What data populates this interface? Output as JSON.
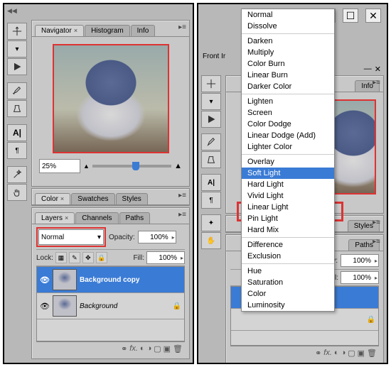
{
  "left": {
    "nav": {
      "tabs": [
        "Navigator",
        "Histogram",
        "Info"
      ],
      "zoom": "25%"
    },
    "color": {
      "tabs": [
        "Color",
        "Swatches",
        "Styles"
      ]
    },
    "layers": {
      "tabs": [
        "Layers",
        "Channels",
        "Paths"
      ],
      "blend": "Normal",
      "opacity_label": "Opacity:",
      "opacity": "100%",
      "lock_label": "Lock:",
      "fill_label": "Fill:",
      "fill": "100%",
      "items": [
        {
          "name": "Background copy",
          "selected": true,
          "locked": false
        },
        {
          "name": "Background",
          "selected": false,
          "locked": true
        }
      ]
    }
  },
  "right": {
    "front_label": "Front Ir",
    "menu": {
      "groups": [
        [
          "Normal",
          "Dissolve"
        ],
        [
          "Darken",
          "Multiply",
          "Color Burn",
          "Linear Burn",
          "Darker Color"
        ],
        [
          "Lighten",
          "Screen",
          "Color Dodge",
          "Linear Dodge (Add)",
          "Lighter Color"
        ],
        [
          "Overlay",
          "Soft Light",
          "Hard Light",
          "Vivid Light",
          "Linear Light",
          "Pin Light",
          "Hard Mix"
        ],
        [
          "Difference",
          "Exclusion"
        ],
        [
          "Hue",
          "Saturation",
          "Color",
          "Luminosity"
        ]
      ],
      "highlighted": "Soft Light"
    },
    "partial": {
      "info": "Info",
      "styles": "Styles",
      "paths": "Paths",
      "opacity": "pacity:",
      "fill": "Fill:",
      "pct": "100%"
    }
  }
}
